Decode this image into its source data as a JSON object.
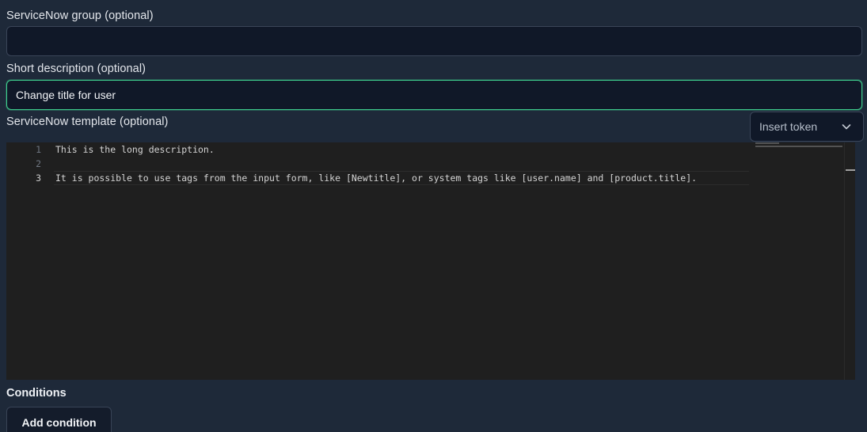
{
  "form": {
    "group_label": "ServiceNow group (optional)",
    "group_value": "",
    "short_desc_label": "Short description (optional)",
    "short_desc_value": "Change title for user",
    "template_label": "ServiceNow template (optional)",
    "insert_token_label": "Insert token"
  },
  "editor": {
    "line_numbers": [
      "1",
      "2",
      "3"
    ],
    "lines": [
      "This is the long description.",
      "",
      "It is possible to use tags from the input form, like [Newtitle], or system tags like [user.name] and [product.title]."
    ]
  },
  "conditions": {
    "title": "Conditions",
    "add_button_label": "Add condition"
  },
  "colors": {
    "background": "#1e2939",
    "input_background": "#101828",
    "focus_border": "#3fcf8e",
    "editor_background": "#1f1f1f"
  }
}
